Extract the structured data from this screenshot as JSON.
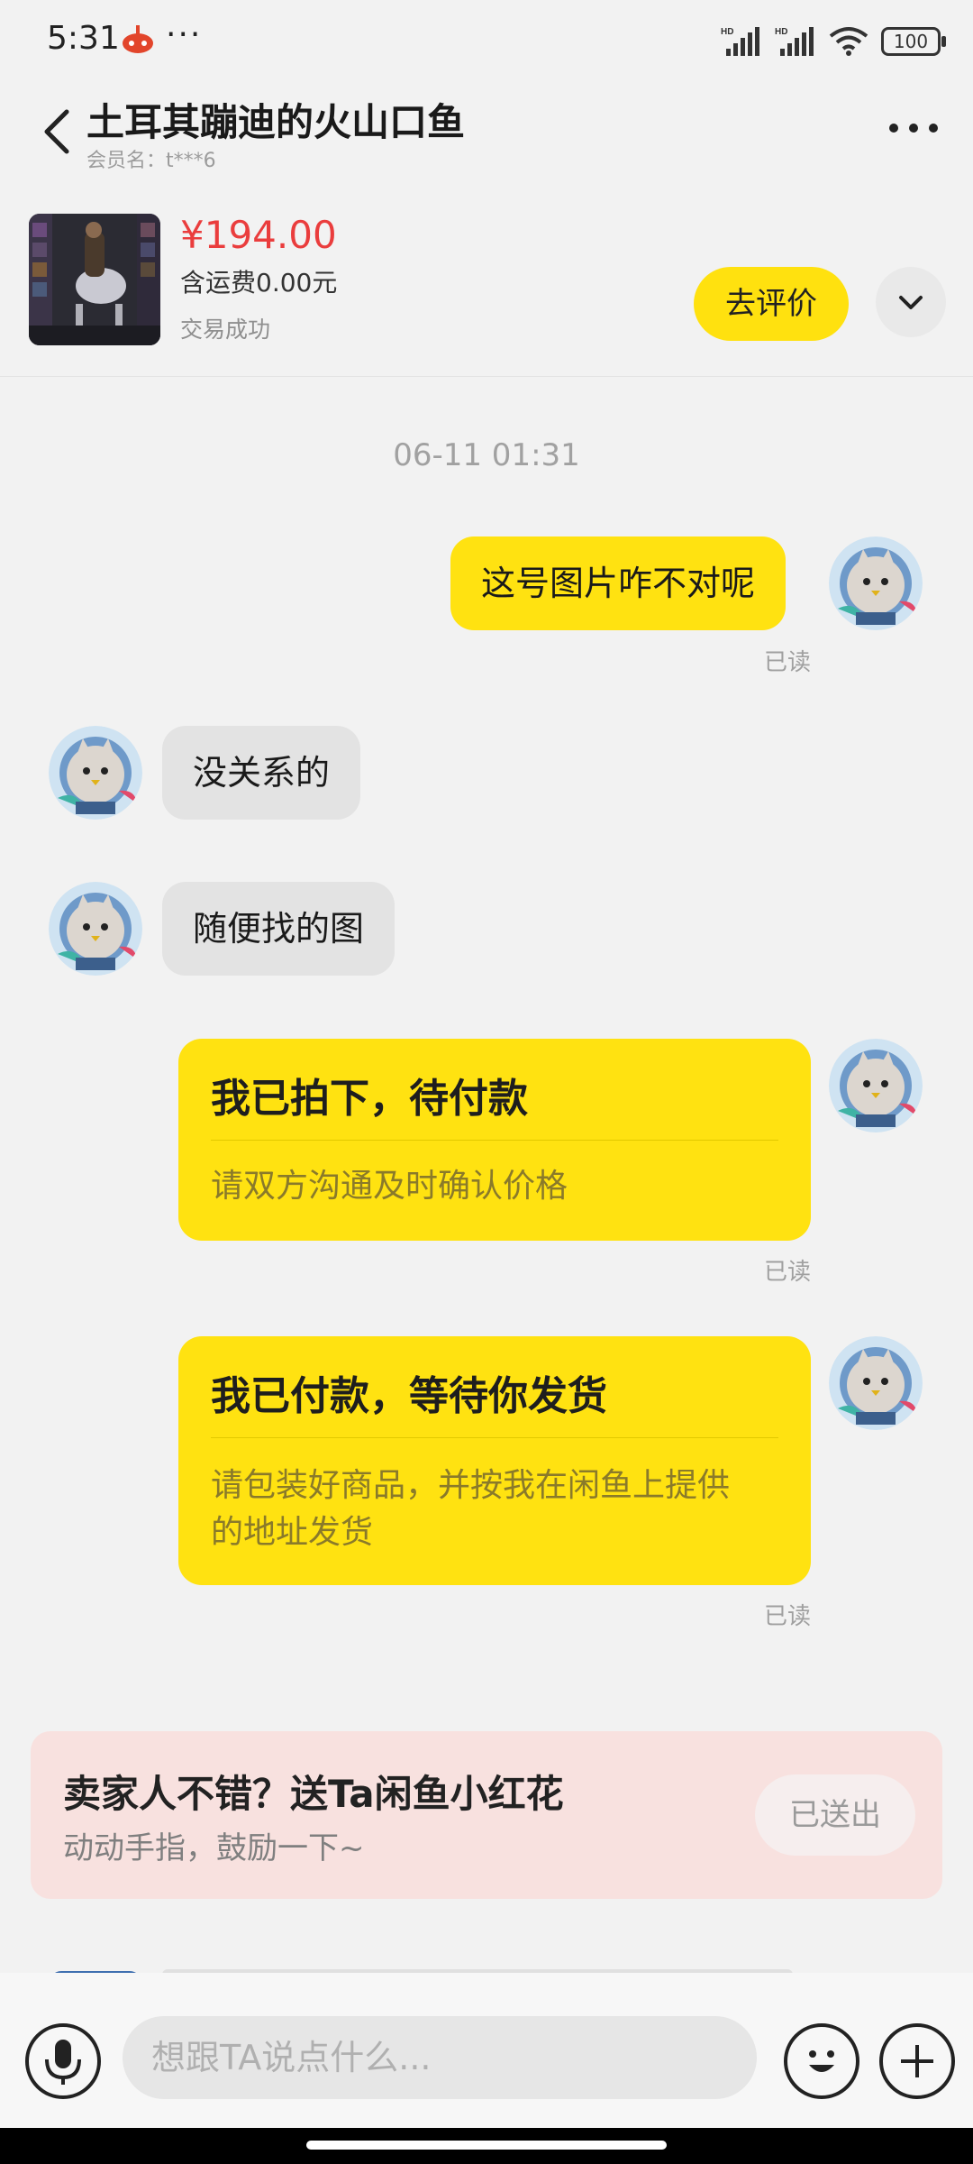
{
  "status_bar": {
    "time": "5:31",
    "dots": "···",
    "battery": "100"
  },
  "header": {
    "title": "土耳其蹦迪的火山口鱼",
    "member_id": "会员名：t***6"
  },
  "product": {
    "price": "¥194.00",
    "shipping": "含运费0.00元",
    "status": "交易成功",
    "review_button": "去评价"
  },
  "timestamp": "06-11 01:31",
  "messages": [
    {
      "from": "me",
      "text": "这号图片咋不对呢",
      "read": "已读"
    },
    {
      "from": "other",
      "text": "没关系的"
    },
    {
      "from": "other",
      "text": "随便找的图"
    },
    {
      "from": "me",
      "type": "card",
      "title": "我已拍下，待付款",
      "body": "请双方沟通及时确认价格",
      "read": "已读"
    },
    {
      "from": "me",
      "type": "card",
      "title": "我已付款，等待你发货",
      "body": "请包装好商品，并按我在闲鱼上提供的地址发货",
      "read": "已读"
    }
  ],
  "flower_banner": {
    "title": "卖家人不错？送Ta闲鱼小红花",
    "subtitle": "动动手指，鼓励一下~",
    "button": "已送出"
  },
  "input": {
    "placeholder": "想跟TA说点什么..."
  },
  "colors": {
    "accent": "#ffe211",
    "price": "#ea3d3d",
    "banner": "#f8e1df"
  }
}
